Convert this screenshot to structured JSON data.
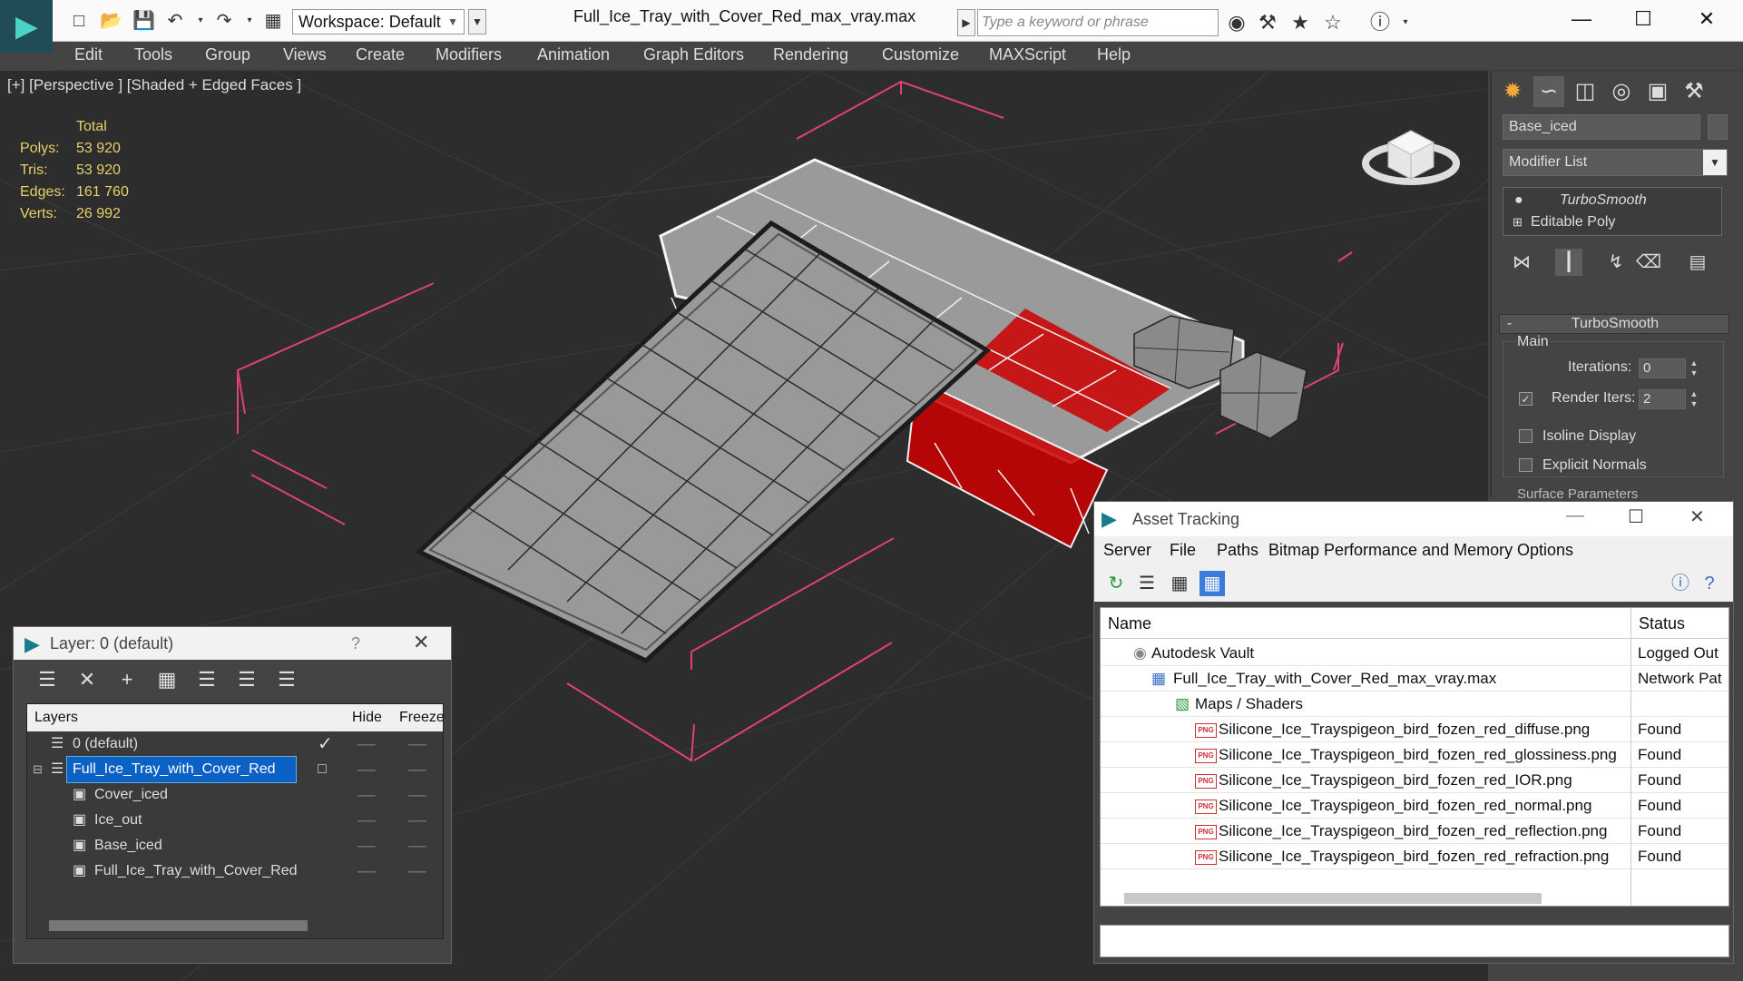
{
  "title_bar": {
    "workspace": "Workspace: Default",
    "document_title": "Full_Ice_Tray_with_Cover_Red_max_vray.max",
    "search_placeholder": "Type a keyword or phrase"
  },
  "menu": [
    "Edit",
    "Tools",
    "Group",
    "Views",
    "Create",
    "Modifiers",
    "Animation",
    "Graph Editors",
    "Rendering",
    "Customize",
    "MAXScript",
    "Help"
  ],
  "viewport": {
    "label": "[+] [Perspective ] [Shaded + Edged Faces ]",
    "stats": {
      "header": "Total",
      "polys_label": "Polys:",
      "polys": "53 920",
      "tris_label": "Tris:",
      "tris": "53 920",
      "edges_label": "Edges:",
      "edges": "161 760",
      "verts_label": "Verts:",
      "verts": "26 992"
    },
    "accent_selection": "#e0407a",
    "accent_red": "#cc0000"
  },
  "command_panel": {
    "object_name": "Base_iced",
    "modifier_list": "Modifier List",
    "stack": [
      "TurboSmooth",
      "Editable Poly"
    ],
    "rollout_title": "TurboSmooth",
    "group_main": "Main",
    "iterations_label": "Iterations:",
    "iterations": "0",
    "render_iters_label": "Render Iters:",
    "render_iters": "2",
    "isoline_label": "Isoline Display",
    "explicit_normals_label": "Explicit Normals",
    "surface_params_label": "Surface Parameters"
  },
  "layer_explorer": {
    "title": "Layer: 0 (default)",
    "help": "?",
    "columns": {
      "layers": "Layers",
      "hide": "Hide",
      "freeze": "Freeze"
    },
    "rows": [
      {
        "name": "0 (default)"
      },
      {
        "name": "Full_Ice_Tray_with_Cover_Red"
      },
      {
        "name": "Cover_iced"
      },
      {
        "name": "Ice_out"
      },
      {
        "name": "Base_iced"
      },
      {
        "name": "Full_Ice_Tray_with_Cover_Red"
      }
    ]
  },
  "asset_tracking": {
    "title": "Asset Tracking",
    "menu": [
      "Server",
      "File",
      "Paths",
      "Bitmap Performance and Memory",
      "Options"
    ],
    "columns": {
      "name": "Name",
      "status": "Status"
    },
    "rows": [
      {
        "name": "Autodesk Vault",
        "status": "Logged Out"
      },
      {
        "name": "Full_Ice_Tray_with_Cover_Red_max_vray.max",
        "status": "Network Pat"
      },
      {
        "name": "Maps / Shaders",
        "status": ""
      },
      {
        "name": "Silicone_Ice_Trayspigeon_bird_fozen_red_diffuse.png",
        "status": "Found"
      },
      {
        "name": "Silicone_Ice_Trayspigeon_bird_fozen_red_glossiness.png",
        "status": "Found"
      },
      {
        "name": "Silicone_Ice_Trayspigeon_bird_fozen_red_IOR.png",
        "status": "Found"
      },
      {
        "name": "Silicone_Ice_Trayspigeon_bird_fozen_red_normal.png",
        "status": "Found"
      },
      {
        "name": "Silicone_Ice_Trayspigeon_bird_fozen_red_reflection.png",
        "status": "Found"
      },
      {
        "name": "Silicone_Ice_Trayspigeon_bird_fozen_red_refraction.png",
        "status": "Found"
      }
    ]
  }
}
